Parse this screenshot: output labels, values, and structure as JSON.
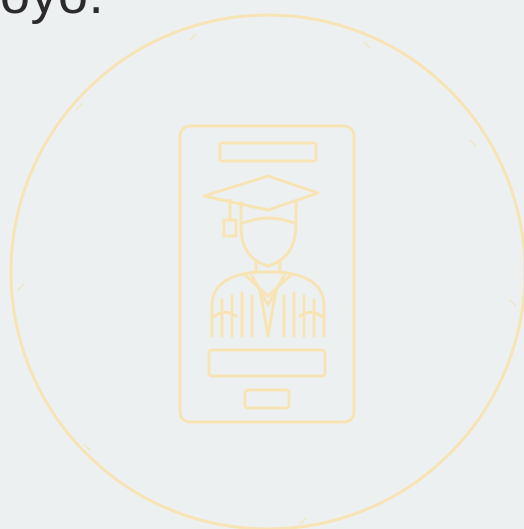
{
  "caption": {
    "text": "oyo."
  },
  "illustration": {
    "icon": "mobile-graduate-icon",
    "stroke_color": "#f7e4b4",
    "background_color": "#edf0f1"
  }
}
